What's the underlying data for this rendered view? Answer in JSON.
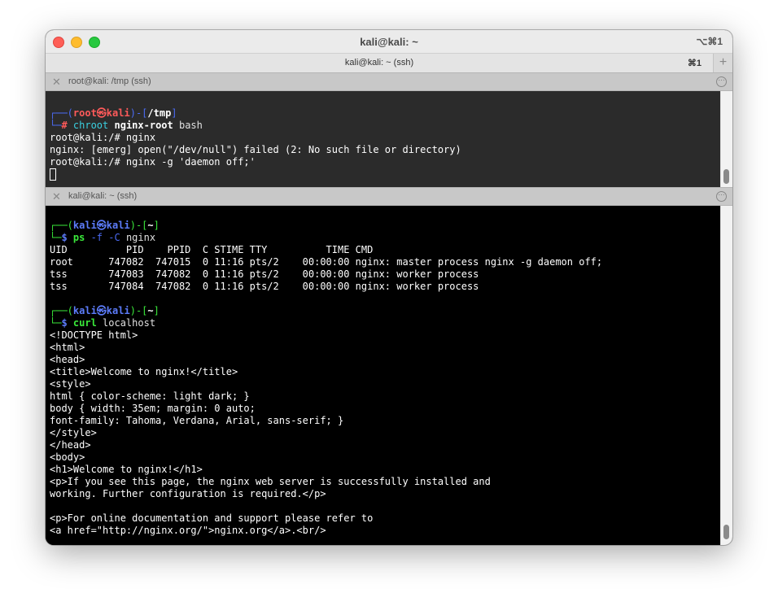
{
  "window": {
    "title": "kali@kali: ~",
    "shortcut": "⌥⌘1"
  },
  "tabbar": {
    "tab_title": "kali@kali: ~ (ssh)",
    "tab_shortcut": "⌘1",
    "add_symbol": "+"
  },
  "pane_top": {
    "title": "root@kali: /tmp (ssh)",
    "close_symbol": "✕",
    "more_symbol": "···",
    "prompt": {
      "corner1": "┌──(",
      "user": "root㉿kali",
      "mid": ")-[",
      "path": "/tmp",
      "end": "]",
      "corner2": "└─",
      "hash": "# ",
      "cmd": "chroot",
      "arg1": " nginx-root",
      "arg2": " bash"
    },
    "lines": [
      "root@kali:/# nginx",
      "nginx: [emerg] open(\"/dev/null\") failed (2: No such file or directory)",
      "root@kali:/# nginx -g 'daemon off;'"
    ]
  },
  "pane_bottom": {
    "title": "kali@kali: ~ (ssh)",
    "close_symbol": "✕",
    "more_symbol": "···",
    "prompt1": {
      "corner1": "┌──(",
      "user": "kali㉿kali",
      "mid": ")-[",
      "path": "~",
      "end": "]",
      "corner2": "└─",
      "dollar": "$ ",
      "cmd": "ps",
      "args": " -f -C",
      "arg2": " nginx"
    },
    "ps_output": [
      "UID          PID    PPID  C STIME TTY          TIME CMD",
      "root      747082  747015  0 11:16 pts/2    00:00:00 nginx: master process nginx -g daemon off;",
      "tss       747083  747082  0 11:16 pts/2    00:00:00 nginx: worker process",
      "tss       747084  747082  0 11:16 pts/2    00:00:00 nginx: worker process"
    ],
    "prompt2": {
      "corner1": "┌──(",
      "user": "kali㉿kali",
      "mid": ")-[",
      "path": "~",
      "end": "]",
      "corner2": "└─",
      "dollar": "$ ",
      "cmd": "curl",
      "arg": " localhost"
    },
    "curl_output": [
      "<!DOCTYPE html>",
      "<html>",
      "<head>",
      "<title>Welcome to nginx!</title>",
      "<style>",
      "html { color-scheme: light dark; }",
      "body { width: 35em; margin: 0 auto;",
      "font-family: Tahoma, Verdana, Arial, sans-serif; }",
      "</style>",
      "</head>",
      "<body>",
      "<h1>Welcome to nginx!</h1>",
      "<p>If you see this page, the nginx web server is successfully installed and",
      "working. Further configuration is required.</p>",
      "",
      "<p>For online documentation and support please refer to",
      "<a href=\"http://nginx.org/\">nginx.org</a>.<br/>"
    ]
  }
}
